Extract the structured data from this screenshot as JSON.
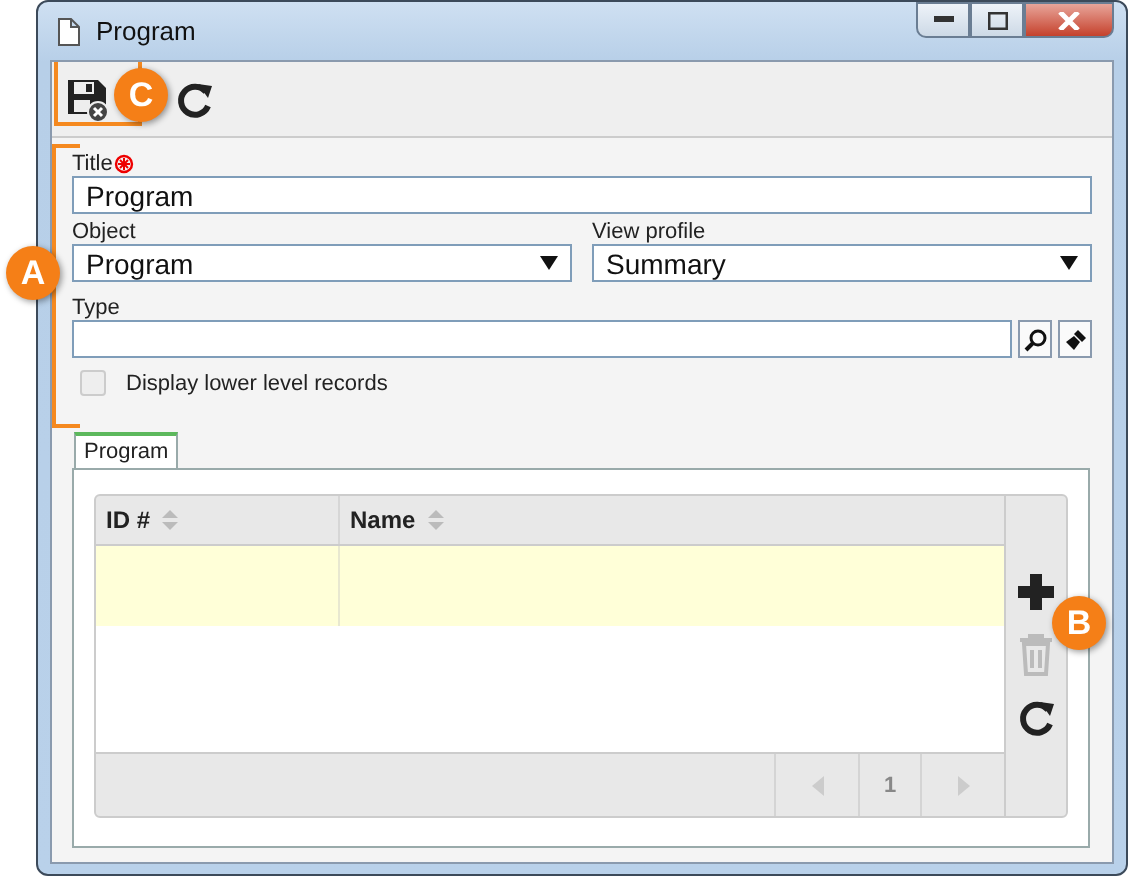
{
  "window": {
    "title": "Program"
  },
  "toolbar": [
    {
      "kind": "save"
    },
    {
      "kind": "refresh"
    }
  ],
  "form": {
    "title": {
      "label": "Title",
      "required": true,
      "value": "Program"
    },
    "object": {
      "label": "Object",
      "value": "Program"
    },
    "view_profile": {
      "label": "View profile",
      "value": "Summary"
    },
    "type": {
      "label": "Type"
    },
    "display_lower": {
      "label": "Display lower level records",
      "checked": false,
      "disabled": true
    }
  },
  "tabs": [
    {
      "label": "Program",
      "selected": true
    }
  ],
  "table": {
    "columns": [
      "ID #",
      "Name"
    ],
    "actions": [
      {
        "kind": "add",
        "disabled": false
      },
      {
        "kind": "delete",
        "disabled": true
      },
      {
        "kind": "refresh",
        "disabled": false
      }
    ],
    "pager": {
      "page": "1"
    }
  },
  "callouts": [
    {
      "label": "A"
    },
    {
      "label": "B"
    },
    {
      "label": "C"
    }
  ]
}
